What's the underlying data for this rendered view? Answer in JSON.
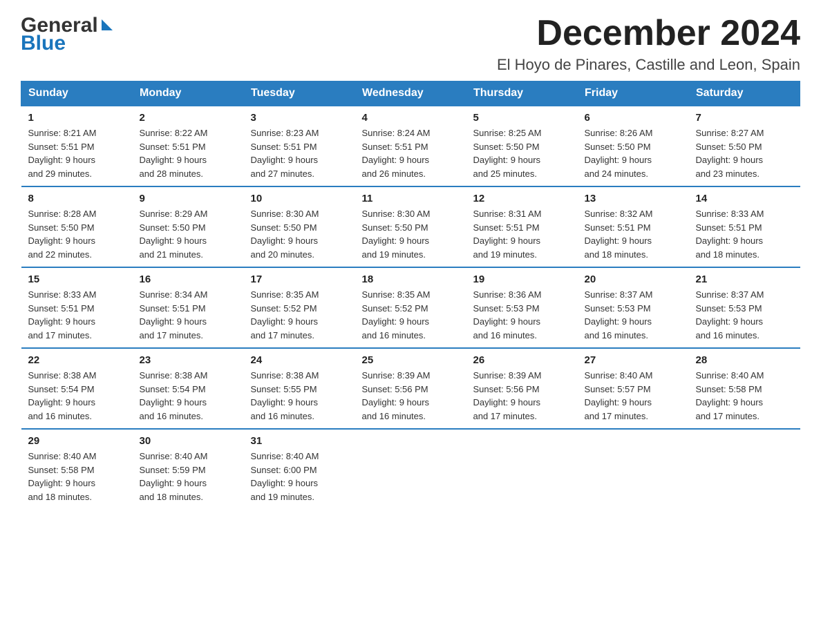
{
  "header": {
    "logo_general": "General",
    "logo_blue": "Blue",
    "month_title": "December 2024",
    "location": "El Hoyo de Pinares, Castille and Leon, Spain"
  },
  "days_of_week": [
    "Sunday",
    "Monday",
    "Tuesday",
    "Wednesday",
    "Thursday",
    "Friday",
    "Saturday"
  ],
  "weeks": [
    [
      {
        "day": "1",
        "info": "Sunrise: 8:21 AM\nSunset: 5:51 PM\nDaylight: 9 hours\nand 29 minutes."
      },
      {
        "day": "2",
        "info": "Sunrise: 8:22 AM\nSunset: 5:51 PM\nDaylight: 9 hours\nand 28 minutes."
      },
      {
        "day": "3",
        "info": "Sunrise: 8:23 AM\nSunset: 5:51 PM\nDaylight: 9 hours\nand 27 minutes."
      },
      {
        "day": "4",
        "info": "Sunrise: 8:24 AM\nSunset: 5:51 PM\nDaylight: 9 hours\nand 26 minutes."
      },
      {
        "day": "5",
        "info": "Sunrise: 8:25 AM\nSunset: 5:50 PM\nDaylight: 9 hours\nand 25 minutes."
      },
      {
        "day": "6",
        "info": "Sunrise: 8:26 AM\nSunset: 5:50 PM\nDaylight: 9 hours\nand 24 minutes."
      },
      {
        "day": "7",
        "info": "Sunrise: 8:27 AM\nSunset: 5:50 PM\nDaylight: 9 hours\nand 23 minutes."
      }
    ],
    [
      {
        "day": "8",
        "info": "Sunrise: 8:28 AM\nSunset: 5:50 PM\nDaylight: 9 hours\nand 22 minutes."
      },
      {
        "day": "9",
        "info": "Sunrise: 8:29 AM\nSunset: 5:50 PM\nDaylight: 9 hours\nand 21 minutes."
      },
      {
        "day": "10",
        "info": "Sunrise: 8:30 AM\nSunset: 5:50 PM\nDaylight: 9 hours\nand 20 minutes."
      },
      {
        "day": "11",
        "info": "Sunrise: 8:30 AM\nSunset: 5:50 PM\nDaylight: 9 hours\nand 19 minutes."
      },
      {
        "day": "12",
        "info": "Sunrise: 8:31 AM\nSunset: 5:51 PM\nDaylight: 9 hours\nand 19 minutes."
      },
      {
        "day": "13",
        "info": "Sunrise: 8:32 AM\nSunset: 5:51 PM\nDaylight: 9 hours\nand 18 minutes."
      },
      {
        "day": "14",
        "info": "Sunrise: 8:33 AM\nSunset: 5:51 PM\nDaylight: 9 hours\nand 18 minutes."
      }
    ],
    [
      {
        "day": "15",
        "info": "Sunrise: 8:33 AM\nSunset: 5:51 PM\nDaylight: 9 hours\nand 17 minutes."
      },
      {
        "day": "16",
        "info": "Sunrise: 8:34 AM\nSunset: 5:51 PM\nDaylight: 9 hours\nand 17 minutes."
      },
      {
        "day": "17",
        "info": "Sunrise: 8:35 AM\nSunset: 5:52 PM\nDaylight: 9 hours\nand 17 minutes."
      },
      {
        "day": "18",
        "info": "Sunrise: 8:35 AM\nSunset: 5:52 PM\nDaylight: 9 hours\nand 16 minutes."
      },
      {
        "day": "19",
        "info": "Sunrise: 8:36 AM\nSunset: 5:53 PM\nDaylight: 9 hours\nand 16 minutes."
      },
      {
        "day": "20",
        "info": "Sunrise: 8:37 AM\nSunset: 5:53 PM\nDaylight: 9 hours\nand 16 minutes."
      },
      {
        "day": "21",
        "info": "Sunrise: 8:37 AM\nSunset: 5:53 PM\nDaylight: 9 hours\nand 16 minutes."
      }
    ],
    [
      {
        "day": "22",
        "info": "Sunrise: 8:38 AM\nSunset: 5:54 PM\nDaylight: 9 hours\nand 16 minutes."
      },
      {
        "day": "23",
        "info": "Sunrise: 8:38 AM\nSunset: 5:54 PM\nDaylight: 9 hours\nand 16 minutes."
      },
      {
        "day": "24",
        "info": "Sunrise: 8:38 AM\nSunset: 5:55 PM\nDaylight: 9 hours\nand 16 minutes."
      },
      {
        "day": "25",
        "info": "Sunrise: 8:39 AM\nSunset: 5:56 PM\nDaylight: 9 hours\nand 16 minutes."
      },
      {
        "day": "26",
        "info": "Sunrise: 8:39 AM\nSunset: 5:56 PM\nDaylight: 9 hours\nand 17 minutes."
      },
      {
        "day": "27",
        "info": "Sunrise: 8:40 AM\nSunset: 5:57 PM\nDaylight: 9 hours\nand 17 minutes."
      },
      {
        "day": "28",
        "info": "Sunrise: 8:40 AM\nSunset: 5:58 PM\nDaylight: 9 hours\nand 17 minutes."
      }
    ],
    [
      {
        "day": "29",
        "info": "Sunrise: 8:40 AM\nSunset: 5:58 PM\nDaylight: 9 hours\nand 18 minutes."
      },
      {
        "day": "30",
        "info": "Sunrise: 8:40 AM\nSunset: 5:59 PM\nDaylight: 9 hours\nand 18 minutes."
      },
      {
        "day": "31",
        "info": "Sunrise: 8:40 AM\nSunset: 6:00 PM\nDaylight: 9 hours\nand 19 minutes."
      },
      {
        "day": "",
        "info": ""
      },
      {
        "day": "",
        "info": ""
      },
      {
        "day": "",
        "info": ""
      },
      {
        "day": "",
        "info": ""
      }
    ]
  ]
}
